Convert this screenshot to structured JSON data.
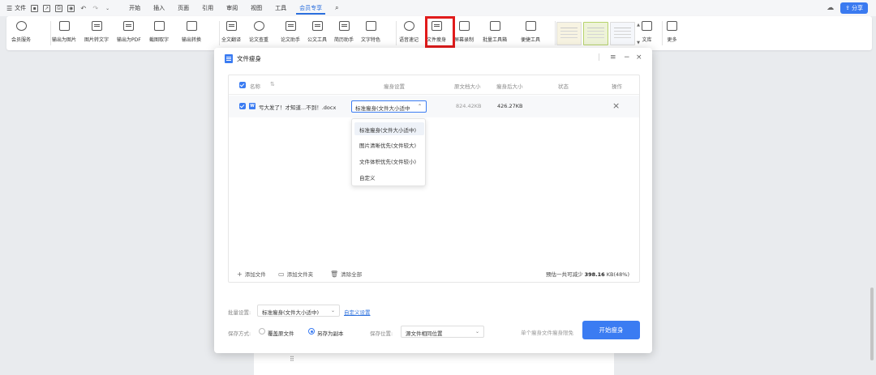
{
  "menubar": {
    "file_label": "文件",
    "tabs": [
      "开始",
      "插入",
      "页面",
      "引用",
      "审阅",
      "视图",
      "工具",
      "会员专享"
    ],
    "active_tab": "会员专享",
    "share_label": "分享",
    "accent_color": "#2b6fdd"
  },
  "ribbon": {
    "tools": [
      "会员服务",
      "输出为图片",
      "图片转文字",
      "输出为PDF",
      "截图取字",
      "输出转换",
      "全文翻译",
      "论文查重",
      "论文助手",
      "公文工具",
      "简历助手",
      "文字特色",
      "语音速记",
      "文件瘦身",
      "屏幕录制",
      "批量工具箱",
      "便捷工具",
      "文库",
      "更多"
    ],
    "highlighted_tool": "文件瘦身",
    "highlight_color": "#e11b1b"
  },
  "dialog": {
    "title": "文件瘦身",
    "columns": {
      "name": "名称",
      "settings": "瘦身设置",
      "orig_size": "原文档大小",
      "slim_size": "瘦身后大小",
      "status": "状态",
      "action": "操作"
    },
    "file": {
      "name": "亏大发了！才知道...不到！.docx",
      "setting": "标准瘦身(文件大小适中",
      "orig_size": "824.42KB",
      "slim_size": "426.27KB",
      "status": ""
    },
    "dropdown_options": [
      "标准瘦身(文件大小适中)",
      "图片清晰优先(文件较大)",
      "文件体积优先(文件较小)",
      "自定义"
    ],
    "selected_option_index": 0,
    "footer": {
      "add_file": "添加文件",
      "add_folder": "添加文件夹",
      "clear_all": "清除全部",
      "estimate_prefix": "预估一共可减少",
      "estimate_value": "398.16",
      "estimate_suffix": "KB(48%)"
    },
    "batch": {
      "label": "批量设置:",
      "value": "标准瘦身(文件大小适中)",
      "custom_link": "自定义设置"
    },
    "save": {
      "label": "保存方式:",
      "option_overwrite": "覆盖原文件",
      "option_copy": "另存为副本",
      "selected": "另存为副本",
      "location_label": "保存位置:",
      "location_value": "源文件相同位置"
    },
    "single_note": "单个瘦身文件瘦身限免",
    "start_button": "开始瘦身",
    "button_color": "#3b7cf2"
  }
}
